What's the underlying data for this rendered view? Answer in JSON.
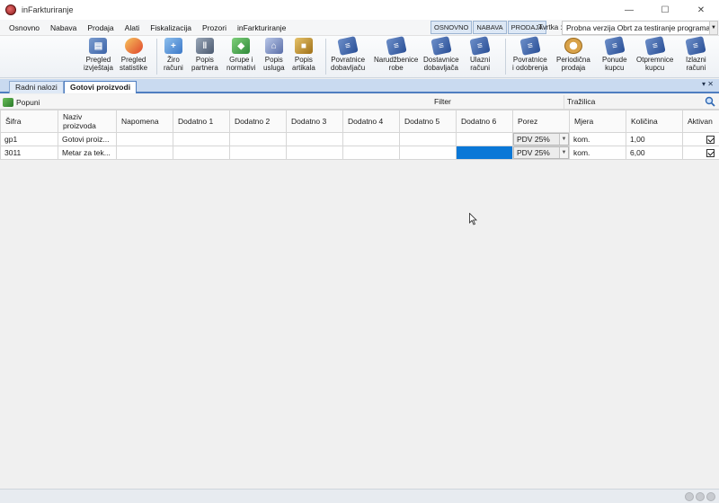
{
  "window": {
    "title": "inFarkturiranje",
    "controls": [
      "—",
      "☐",
      "✕"
    ]
  },
  "menu": [
    "Osnovno",
    "Nabava",
    "Prodaja",
    "Alati",
    "Fiskalizacija",
    "Prozori",
    "inFarkturiranje"
  ],
  "modes": [
    "OSNOVNO",
    "NABAVA",
    "PRODAJA"
  ],
  "company": {
    "label": "Tvrtka :",
    "value": "Probna verzija Obrt za testiranje programa"
  },
  "toolbar": [
    {
      "label": "Pregled\nizvještaja",
      "icon": "report-icon"
    },
    {
      "label": "Pregled\nstatistike",
      "icon": "statistics-icon"
    },
    {
      "label": "Žiro\nračuni",
      "icon": "bank-account-icon"
    },
    {
      "label": "Popis\npartnera",
      "icon": "partners-icon"
    },
    {
      "label": "Grupe i\nnormativi",
      "icon": "groups-icon"
    },
    {
      "label": "Popis\nusluga",
      "icon": "services-icon"
    },
    {
      "label": "Popis\nartikala",
      "icon": "articles-icon"
    },
    {
      "label": "Povratnice\ndobavljaču",
      "icon": "supplier-returns-icon"
    },
    {
      "label": "Narudžbenice\nrobe",
      "icon": "purchase-orders-icon"
    },
    {
      "label": "Dostavnice\ndobavljača",
      "icon": "supplier-delivery-icon"
    },
    {
      "label": "Ulazni\nračuni",
      "icon": "incoming-invoices-icon"
    },
    {
      "label": "Povratnice\ni odobrenja",
      "icon": "returns-credits-icon"
    },
    {
      "label": "Periodična\nprodaja",
      "icon": "periodic-sales-icon"
    },
    {
      "label": "Ponude\nkupcu",
      "icon": "customer-offers-icon"
    },
    {
      "label": "Otpremnice\nkupcu",
      "icon": "customer-dispatch-icon"
    },
    {
      "label": "Izlazni\nračuni",
      "icon": "outgoing-invoices-icon"
    }
  ],
  "tabs": [
    "Radni nalozi",
    "Gotovi proizvodi"
  ],
  "tab_controls": "▾ ✕",
  "subtoolbar": {
    "fill_label": "Popuni",
    "filter_label": "Filter",
    "search_label": "Tražilica"
  },
  "grid": {
    "columns": [
      "Šifra",
      "Naziv\nproizvoda",
      "Napomena",
      "Dodatno 1",
      "Dodatno 2",
      "Dodatno 3",
      "Dodatno 4",
      "Dodatno 5",
      "Dodatno 6",
      "Porez",
      "Mjera",
      "Količina",
      "Aktivan"
    ],
    "rows": [
      {
        "sifra": "gp1",
        "naziv": "Gotovi proiz...",
        "napomena": "",
        "d1": "",
        "d2": "",
        "d3": "",
        "d4": "",
        "d5": "",
        "d6": "",
        "porez": "PDV 25%",
        "mjera": "kom.",
        "kolicina": "1,00",
        "aktivan": true
      },
      {
        "sifra": "3011",
        "naziv": "Metar za tek...",
        "napomena": "",
        "d1": "",
        "d2": "",
        "d3": "",
        "d4": "",
        "d5": "",
        "d6": "",
        "porez": "PDV 25%",
        "mjera": "kom.",
        "kolicina": "6,00",
        "aktivan": true
      }
    ]
  },
  "colors": {
    "accent": "#4f7ec0",
    "selection": "#0a78d7"
  }
}
